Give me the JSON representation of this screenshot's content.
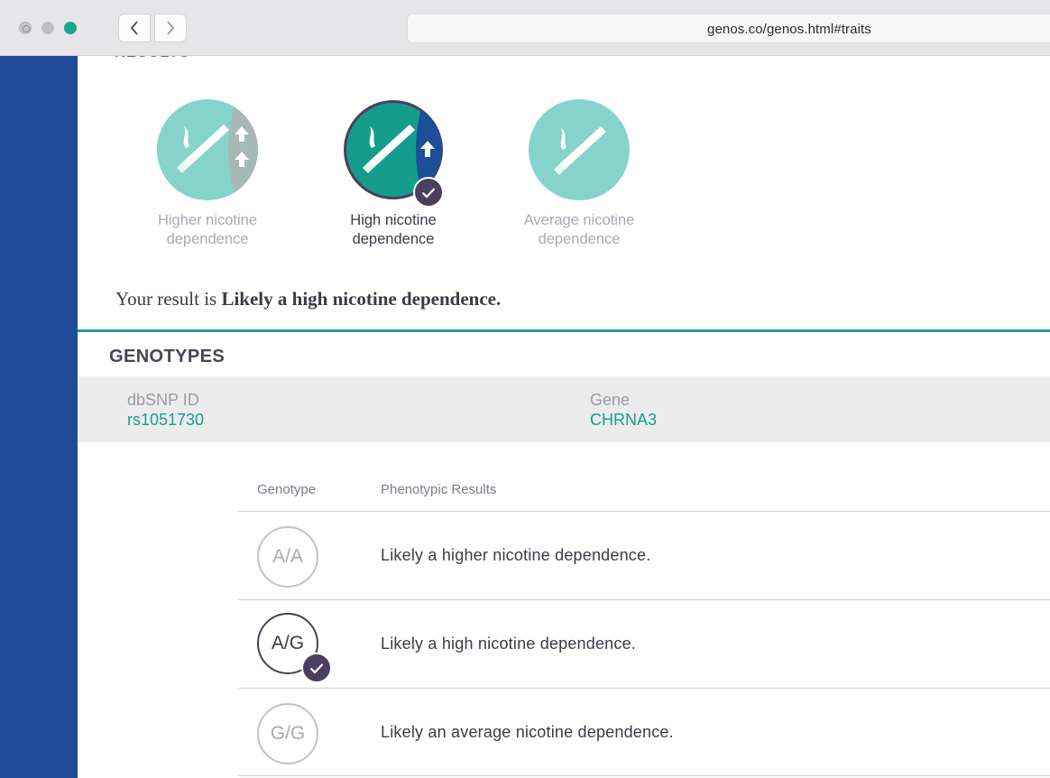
{
  "browser": {
    "url": "genos.co/genos.html#traits"
  },
  "results": {
    "heading": "RESULTS",
    "traits": [
      {
        "line1": "Higher nicotine",
        "line2": "dependence",
        "selected": false
      },
      {
        "line1": "High nicotine",
        "line2": "dependence",
        "selected": true
      },
      {
        "line1": "Average nicotine",
        "line2": "dependence",
        "selected": false
      }
    ],
    "sentence_prefix": "Your result is ",
    "sentence_bold": "Likely a high nicotine dependence."
  },
  "genotypes": {
    "title": "GENOTYPES",
    "dbsnp_label": "dbSNP ID",
    "dbsnp_value": "rs1051730",
    "gene_label": "Gene",
    "gene_value": "CHRNA3",
    "col_genotype": "Genotype",
    "col_phenotype": "Phenotypic Results",
    "rows": [
      {
        "genotype": "A/A",
        "result": "Likely a higher nicotine dependence.",
        "selected": false
      },
      {
        "genotype": "A/G",
        "result": "Likely a high nicotine dependence.",
        "selected": true
      },
      {
        "genotype": "G/G",
        "result": "Likely an average nicotine dependence.",
        "selected": false
      }
    ]
  },
  "colors": {
    "sidebar_blue": "#1e4b97",
    "teal_light": "#86d3cc",
    "teal_dark": "#159d8c",
    "accent_teal": "#13a08f",
    "check_purple": "#4a3f5e"
  }
}
